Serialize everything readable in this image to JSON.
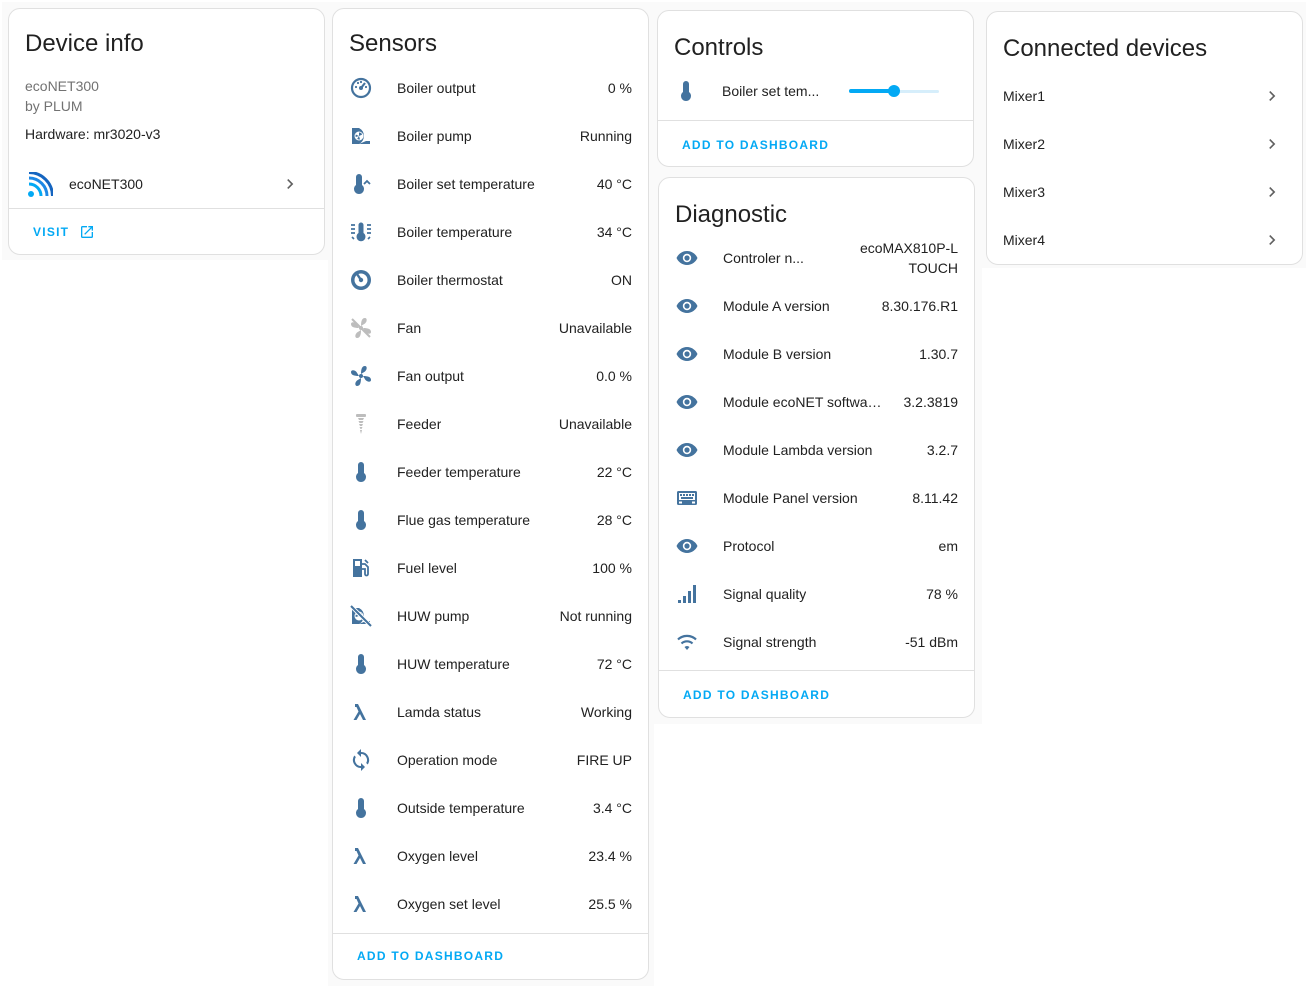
{
  "device_info": {
    "title": "Device info",
    "model": "ecoNET300",
    "manufacturer": "by PLUM",
    "hardware": "Hardware: mr3020-v3",
    "integration_label": "ecoNET300",
    "visit_label": "VISIT"
  },
  "sensors": {
    "title": "Sensors",
    "items": [
      {
        "icon": "gauge-icon",
        "label": "Boiler output",
        "value": "0 %"
      },
      {
        "icon": "pump-icon",
        "label": "Boiler pump",
        "value": "Running"
      },
      {
        "icon": "thermometer-chevron-up-icon",
        "label": "Boiler set temperature",
        "value": "40 °C"
      },
      {
        "icon": "thermometer-lines-icon",
        "label": "Boiler temperature",
        "value": "34 °C"
      },
      {
        "icon": "thermostat-icon",
        "label": "Boiler thermostat",
        "value": "ON"
      },
      {
        "icon": "fan-off-icon",
        "label": "Fan",
        "value": "Unavailable"
      },
      {
        "icon": "fan-icon",
        "label": "Fan output",
        "value": "0.0 %"
      },
      {
        "icon": "screw-feeder-icon",
        "label": "Feeder",
        "value": "Unavailable"
      },
      {
        "icon": "thermometer-icon",
        "label": "Feeder temperature",
        "value": "22 °C"
      },
      {
        "icon": "thermometer-icon",
        "label": "Flue gas temperature",
        "value": "28 °C"
      },
      {
        "icon": "gas-station-icon",
        "label": "Fuel level",
        "value": "100 %"
      },
      {
        "icon": "pump-off-icon",
        "label": "HUW pump",
        "value": "Not running"
      },
      {
        "icon": "thermometer-icon",
        "label": "HUW temperature",
        "value": "72 °C"
      },
      {
        "icon": "lambda-icon",
        "label": "Lamda status",
        "value": "Working"
      },
      {
        "icon": "sync-icon",
        "label": "Operation mode",
        "value": "FIRE UP"
      },
      {
        "icon": "thermometer-icon",
        "label": "Outside temperature",
        "value": "3.4 °C"
      },
      {
        "icon": "lambda-icon",
        "label": "Oxygen level",
        "value": "23.4 %"
      },
      {
        "icon": "lambda-icon",
        "label": "Oxygen set level",
        "value": "25.5 %"
      }
    ],
    "add_label": "ADD TO DASHBOARD"
  },
  "controls": {
    "title": "Controls",
    "items": [
      {
        "icon": "thermometer-icon",
        "label": "Boiler set tem...",
        "slider_fraction": 0.5
      }
    ],
    "add_label": "ADD TO DASHBOARD"
  },
  "diagnostic": {
    "title": "Diagnostic",
    "items": [
      {
        "icon": "eye-icon",
        "label": "Controler n...",
        "value": "ecoMAX810P-L",
        "value_line2": "TOUCH"
      },
      {
        "icon": "eye-icon",
        "label": "Module A version",
        "value": "8.30.176.R1"
      },
      {
        "icon": "eye-icon",
        "label": "Module B version",
        "value": "1.30.7"
      },
      {
        "icon": "eye-icon",
        "label": "Module ecoNET software ...",
        "value": "3.2.3819"
      },
      {
        "icon": "eye-icon",
        "label": "Module Lambda version",
        "value": "3.2.7"
      },
      {
        "icon": "panel-icon",
        "label": "Module Panel version",
        "value": "8.11.42"
      },
      {
        "icon": "eye-icon",
        "label": "Protocol",
        "value": "em"
      },
      {
        "icon": "signal-bars-icon",
        "label": "Signal quality",
        "value": "78 %"
      },
      {
        "icon": "wifi-icon",
        "label": "Signal strength",
        "value": "-51 dBm"
      }
    ],
    "add_label": "ADD TO DASHBOARD"
  },
  "connected": {
    "title": "Connected devices",
    "items": [
      {
        "label": "Mixer1"
      },
      {
        "label": "Mixer2"
      },
      {
        "label": "Mixer3"
      },
      {
        "label": "Mixer4"
      }
    ]
  },
  "colors": {
    "icon": "#44739e",
    "icon_disabled": "#bdbdbd",
    "accent": "#03a9f4",
    "text": "#212121",
    "secondary_text": "#727272",
    "divider": "#e0e0e0"
  }
}
